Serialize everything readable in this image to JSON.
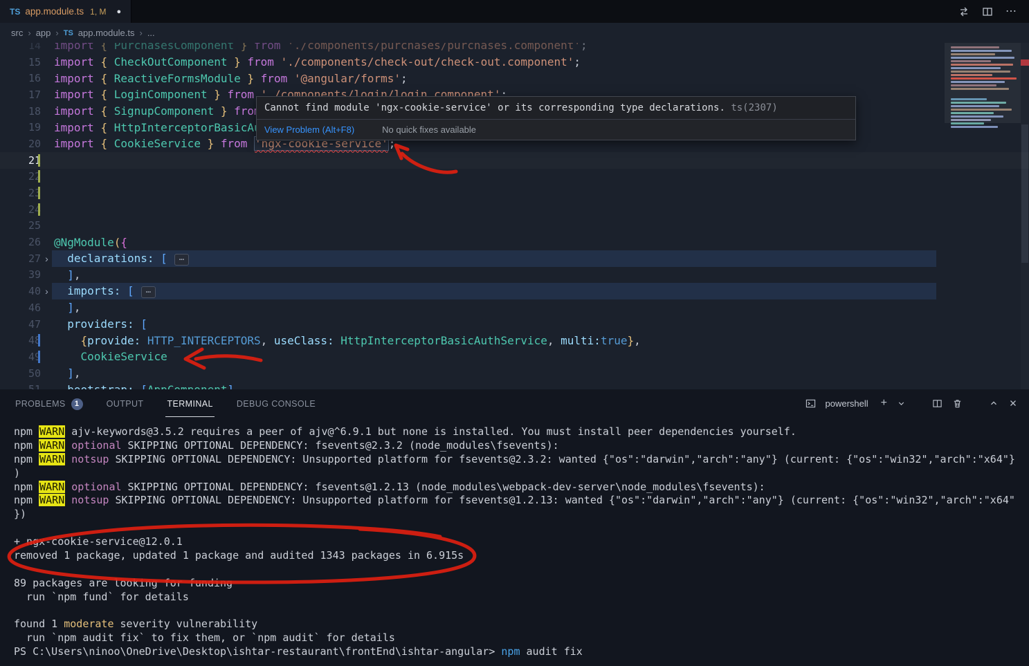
{
  "icons": {
    "ts": "TS",
    "dirty_dot": "●",
    "plus": "+",
    "more": "⋯"
  },
  "titlebar": {
    "tab": {
      "title": "app.module.ts",
      "decoration": "1, M"
    }
  },
  "breadcrumb": {
    "items": [
      "src",
      "app",
      "app.module.ts",
      "..."
    ]
  },
  "tooltip": {
    "message": "Cannot find module 'ngx-cookie-service' or its corresponding type declarations.",
    "code": "ts(2307)",
    "link": "View Problem (Alt+F8)",
    "note": "No quick fixes available"
  },
  "editor": {
    "lines": [
      {
        "num": "14",
        "dim": true,
        "tokens": [
          [
            "kw",
            "import"
          ],
          [
            "fg",
            " "
          ],
          [
            "b1",
            "{"
          ],
          [
            "fg",
            " "
          ],
          [
            "cls",
            "PurchasesComponent"
          ],
          [
            "fg",
            " "
          ],
          [
            "b1",
            "}"
          ],
          [
            "fg",
            " "
          ],
          [
            "kw",
            "from"
          ],
          [
            "fg",
            " "
          ],
          [
            "str",
            "'./components/purchases/purchases.component'"
          ],
          [
            "fg",
            ";"
          ]
        ]
      },
      {
        "num": "15",
        "tokens": [
          [
            "kw",
            "import"
          ],
          [
            "fg",
            " "
          ],
          [
            "b1",
            "{"
          ],
          [
            "fg",
            " "
          ],
          [
            "cls",
            "CheckOutComponent"
          ],
          [
            "fg",
            " "
          ],
          [
            "b1",
            "}"
          ],
          [
            "fg",
            " "
          ],
          [
            "kw",
            "from"
          ],
          [
            "fg",
            " "
          ],
          [
            "str",
            "'./components/check-out/check-out.component'"
          ],
          [
            "fg",
            ";"
          ]
        ]
      },
      {
        "num": "16",
        "tokens": [
          [
            "kw",
            "import"
          ],
          [
            "fg",
            " "
          ],
          [
            "b1",
            "{"
          ],
          [
            "fg",
            " "
          ],
          [
            "cls",
            "ReactiveFormsModule"
          ],
          [
            "fg",
            " "
          ],
          [
            "b1",
            "}"
          ],
          [
            "fg",
            " "
          ],
          [
            "kw",
            "from"
          ],
          [
            "fg",
            " "
          ],
          [
            "str",
            "'@angular/forms'"
          ],
          [
            "fg",
            ";"
          ]
        ]
      },
      {
        "num": "17",
        "tokens": [
          [
            "kw",
            "import"
          ],
          [
            "fg",
            " "
          ],
          [
            "b1",
            "{"
          ],
          [
            "fg",
            " "
          ],
          [
            "cls",
            "LoginComponent"
          ],
          [
            "fg",
            " "
          ],
          [
            "b1",
            "}"
          ],
          [
            "fg",
            " "
          ],
          [
            "kw",
            "from"
          ],
          [
            "fg",
            " "
          ],
          [
            "str",
            "'./components/login/login.component'"
          ],
          [
            "fg",
            ";"
          ]
        ]
      },
      {
        "num": "18",
        "tokens": [
          [
            "kw",
            "import"
          ],
          [
            "fg",
            " "
          ],
          [
            "b1",
            "{"
          ],
          [
            "fg",
            " "
          ],
          [
            "cls",
            "SignupComponent"
          ],
          [
            "fg",
            " "
          ],
          [
            "b1",
            "}"
          ],
          [
            "fg",
            " "
          ],
          [
            "kw",
            "from"
          ],
          [
            "fg",
            " "
          ]
        ]
      },
      {
        "num": "19",
        "tokens": [
          [
            "kw",
            "import"
          ],
          [
            "fg",
            " "
          ],
          [
            "b1",
            "{"
          ],
          [
            "fg",
            " "
          ],
          [
            "cls",
            "HttpInterceptorBasicAuthService"
          ],
          [
            "fg",
            " "
          ],
          [
            "b1",
            "}"
          ],
          [
            "fg",
            " "
          ],
          [
            "kw",
            "from"
          ],
          [
            "fg",
            " "
          ]
        ]
      },
      {
        "num": "20",
        "tokens": [
          [
            "kw",
            "import"
          ],
          [
            "fg",
            " "
          ],
          [
            "b1",
            "{"
          ],
          [
            "fg",
            " "
          ],
          [
            "cls",
            "CookieService"
          ],
          [
            "fg",
            " "
          ],
          [
            "b1",
            "}"
          ],
          [
            "fg",
            " "
          ],
          [
            "kw",
            "from"
          ],
          [
            "fg",
            " "
          ],
          [
            "strerr",
            "'ngx-cookie-service'"
          ],
          [
            "fg",
            ";"
          ]
        ]
      },
      {
        "num": "21",
        "current": true,
        "bar": "mod",
        "tokens": []
      },
      {
        "num": "22",
        "bar": "mod",
        "tokens": []
      },
      {
        "num": "23",
        "bar": "mod",
        "tokens": []
      },
      {
        "num": "24",
        "bar": "mod",
        "tokens": []
      },
      {
        "num": "25",
        "tokens": []
      },
      {
        "num": "26",
        "tokens": [
          [
            "deco",
            "@NgModule"
          ],
          [
            "b1",
            "("
          ],
          [
            "b2",
            "{"
          ]
        ]
      },
      {
        "num": "27",
        "fold": true,
        "band": true,
        "tokens": [
          [
            "fg",
            "  "
          ],
          [
            "prop",
            "declarations:"
          ],
          [
            "fg",
            " "
          ],
          [
            "b3",
            "["
          ],
          [
            "badge",
            "⋯"
          ]
        ]
      },
      {
        "num": "39",
        "tokens": [
          [
            "fg",
            "  "
          ],
          [
            "b3",
            "]"
          ],
          [
            "fg",
            ","
          ]
        ]
      },
      {
        "num": "40",
        "fold": true,
        "band": true,
        "tokens": [
          [
            "fg",
            "  "
          ],
          [
            "prop",
            "imports:"
          ],
          [
            "fg",
            " "
          ],
          [
            "b3",
            "["
          ],
          [
            "badge",
            "⋯"
          ]
        ]
      },
      {
        "num": "46",
        "tokens": [
          [
            "fg",
            "  "
          ],
          [
            "b3",
            "]"
          ],
          [
            "fg",
            ","
          ]
        ]
      },
      {
        "num": "47",
        "tokens": [
          [
            "fg",
            "  "
          ],
          [
            "prop",
            "providers:"
          ],
          [
            "fg",
            " "
          ],
          [
            "b3",
            "["
          ]
        ]
      },
      {
        "num": "48",
        "bar": "edit",
        "tokens": [
          [
            "fg",
            "    "
          ],
          [
            "b1",
            "{"
          ],
          [
            "prop",
            "provide:"
          ],
          [
            "fg",
            " "
          ],
          [
            "const",
            "HTTP_INTERCEPTORS"
          ],
          [
            "fg",
            ", "
          ],
          [
            "prop",
            "useClass:"
          ],
          [
            "fg",
            " "
          ],
          [
            "cls",
            "HttpInterceptorBasicAuthService"
          ],
          [
            "fg",
            ", "
          ],
          [
            "prop",
            "multi:"
          ],
          [
            "const",
            "true"
          ],
          [
            "b1",
            "}"
          ],
          [
            "fg",
            ","
          ]
        ]
      },
      {
        "num": "49",
        "bar": "edit",
        "tokens": [
          [
            "fg",
            "    "
          ],
          [
            "cls",
            "CookieService"
          ]
        ]
      },
      {
        "num": "50",
        "tokens": [
          [
            "fg",
            "  "
          ],
          [
            "b3",
            "]"
          ],
          [
            "fg",
            ","
          ]
        ]
      },
      {
        "num": "51",
        "tokens": [
          [
            "fg",
            "  "
          ],
          [
            "prop",
            "bootstrap:"
          ],
          [
            "fg",
            " "
          ],
          [
            "b3",
            "["
          ],
          [
            "cls",
            "AppComponent"
          ],
          [
            "b3",
            "]"
          ]
        ]
      }
    ]
  },
  "panel": {
    "tabs": [
      {
        "label": "PROBLEMS",
        "badge": "1"
      },
      {
        "label": "OUTPUT"
      },
      {
        "label": "TERMINAL",
        "active": true
      },
      {
        "label": "DEBUG CONSOLE"
      }
    ],
    "shell_label": "powershell"
  },
  "terminal": {
    "lines": [
      [
        [
          "t",
          "npm "
        ],
        [
          "chip",
          "WARN"
        ],
        [
          "t",
          " ajv-keywords@3.5.2 requires a peer of ajv@^6.9.1 but none is installed. You must install peer dependencies yourself."
        ]
      ],
      [
        [
          "t",
          "npm "
        ],
        [
          "chip",
          "WARN"
        ],
        [
          "t",
          " "
        ],
        [
          "mag",
          "optional"
        ],
        [
          "t",
          " SKIPPING OPTIONAL DEPENDENCY: fsevents@2.3.2 (node_modules\\fsevents):"
        ]
      ],
      [
        [
          "t",
          "npm "
        ],
        [
          "chip",
          "WARN"
        ],
        [
          "t",
          " "
        ],
        [
          "mag",
          "notsup"
        ],
        [
          "t",
          " SKIPPING OPTIONAL DEPENDENCY: Unsupported platform for fsevents@2.3.2: wanted {\"os\":\"darwin\",\"arch\":\"any\"} (current: {\"os\":\"win32\",\"arch\":\"x64\"}"
        ]
      ],
      [
        [
          "t",
          ")"
        ]
      ],
      [
        [
          "t",
          "npm "
        ],
        [
          "chip",
          "WARN"
        ],
        [
          "t",
          " "
        ],
        [
          "mag",
          "optional"
        ],
        [
          "t",
          " SKIPPING OPTIONAL DEPENDENCY: fsevents@1.2.13 (node_modules\\webpack-dev-server\\node_modules\\fsevents):"
        ]
      ],
      [
        [
          "t",
          "npm "
        ],
        [
          "chip",
          "WARN"
        ],
        [
          "t",
          " "
        ],
        [
          "mag",
          "notsup"
        ],
        [
          "t",
          " SKIPPING OPTIONAL DEPENDENCY: Unsupported platform for fsevents@1.2.13: wanted {\"os\":\"darwin\",\"arch\":\"any\"} (current: {\"os\":\"win32\",\"arch\":\"x64\""
        ]
      ],
      [
        [
          "t",
          "})"
        ]
      ],
      [],
      [
        [
          "t",
          "+ ngx-cookie-service@12.0.1"
        ]
      ],
      [
        [
          "t",
          "removed 1 package, updated 1 package and audited 1343 packages in 6.915s"
        ]
      ],
      [],
      [
        [
          "t",
          "89 packages are looking for funding"
        ]
      ],
      [
        [
          "t",
          "  run `npm fund` for details"
        ]
      ],
      [],
      [
        [
          "t",
          "found 1 "
        ],
        [
          "yel",
          "moderate"
        ],
        [
          "t",
          " severity vulnerability"
        ]
      ],
      [
        [
          "t",
          "  run `npm audit fix` to fix them, or `npm audit` for details"
        ]
      ],
      [
        [
          "t",
          "PS C:\\Users\\ninoo\\OneDrive\\Desktop\\ishtar-restaurant\\frontEnd\\ishtar-angular> "
        ],
        [
          "cmd",
          "npm"
        ],
        [
          "t",
          " audit fix"
        ]
      ]
    ]
  }
}
